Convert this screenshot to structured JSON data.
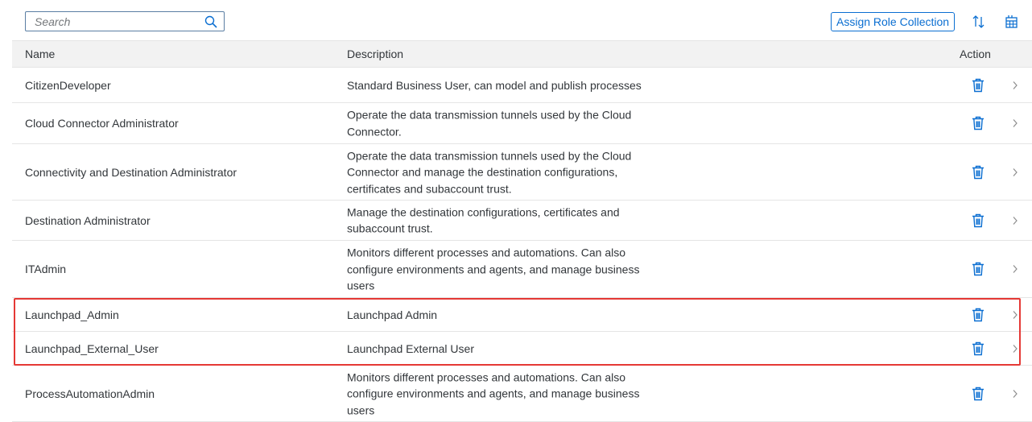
{
  "toolbar": {
    "search_placeholder": "Search",
    "assign_button_label": "Assign Role Collection",
    "icons": [
      "search-icon",
      "sort-icon",
      "table-settings-icon"
    ]
  },
  "table": {
    "columns": {
      "name": "Name",
      "description": "Description",
      "action": "Action"
    },
    "rows": [
      {
        "name": "CitizenDeveloper",
        "description": "Standard Business User, can model and publish processes"
      },
      {
        "name": "Cloud Connector Administrator",
        "description": "Operate the data transmission tunnels used by the Cloud Connector."
      },
      {
        "name": "Connectivity and Destination Administrator",
        "description": "Operate the data transmission tunnels used by the Cloud Connector and manage the destination configurations, certificates and subaccount trust."
      },
      {
        "name": "Destination Administrator",
        "description": "Manage the destination configurations, certificates and subaccount trust."
      },
      {
        "name": "ITAdmin",
        "description": "Monitors different processes and automations. Can also configure environments and agents, and manage business users"
      },
      {
        "name": "Launchpad_Admin",
        "description": "Launchpad Admin"
      },
      {
        "name": "Launchpad_External_User",
        "description": "Launchpad External User"
      },
      {
        "name": "ProcessAutomationAdmin",
        "description": "Monitors different processes and automations. Can also configure environments and agents, and manage business users"
      }
    ]
  },
  "colors": {
    "accent": "#0a6ed1",
    "highlight": "#e53935",
    "header_bg": "#f2f2f2"
  }
}
